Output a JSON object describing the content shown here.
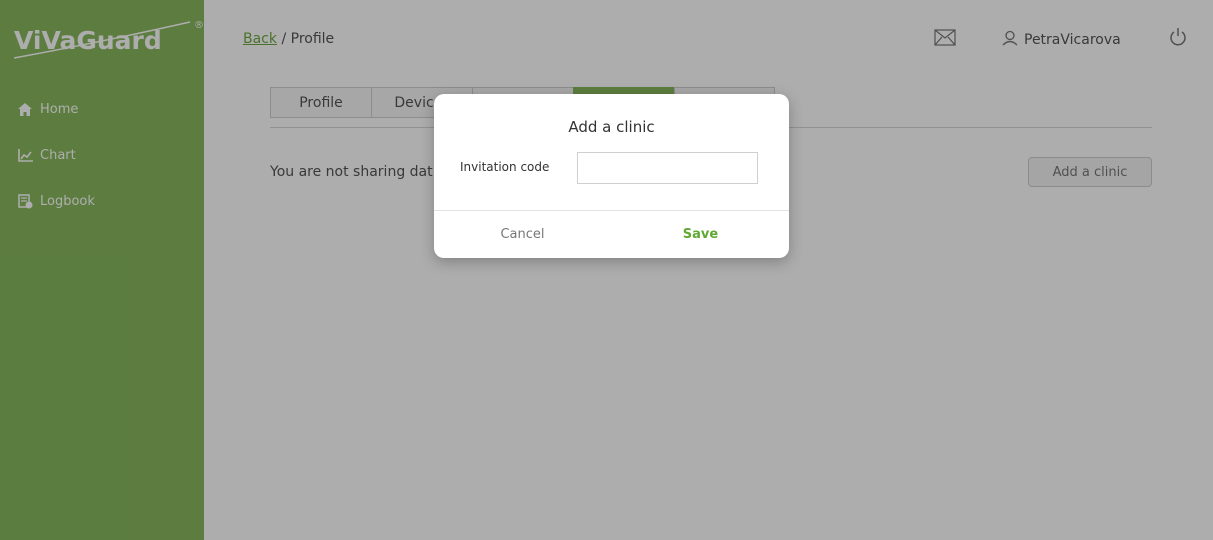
{
  "brand": {
    "name": "ViVaGuard",
    "registered": "®"
  },
  "sidebar": {
    "items": [
      {
        "label": "Home",
        "icon": "home-icon"
      },
      {
        "label": "Chart",
        "icon": "chart-icon"
      },
      {
        "label": "Logbook",
        "icon": "logbook-icon"
      }
    ]
  },
  "header": {
    "back_label": "Back",
    "crumb_rest": " / Profile",
    "username": "PetraVicarova",
    "mail_icon": "mail-icon",
    "user_icon": "user-icon",
    "power_icon": "power-icon"
  },
  "card": {
    "tabs": [
      {
        "label": "Profile"
      },
      {
        "label": "Devices"
      },
      {
        "label": ""
      },
      {
        "label": ""
      }
    ],
    "notice": "You are not sharing dat",
    "add_button": "Add a clinic"
  },
  "modal": {
    "title": "Add a clinic",
    "field_label": "Invitation code",
    "field_value": "",
    "field_placeholder": "",
    "cancel_label": "Cancel",
    "save_label": "Save"
  },
  "colors": {
    "accent": "#88b85e",
    "save_text": "#5fa832",
    "link": "#6fa840"
  }
}
